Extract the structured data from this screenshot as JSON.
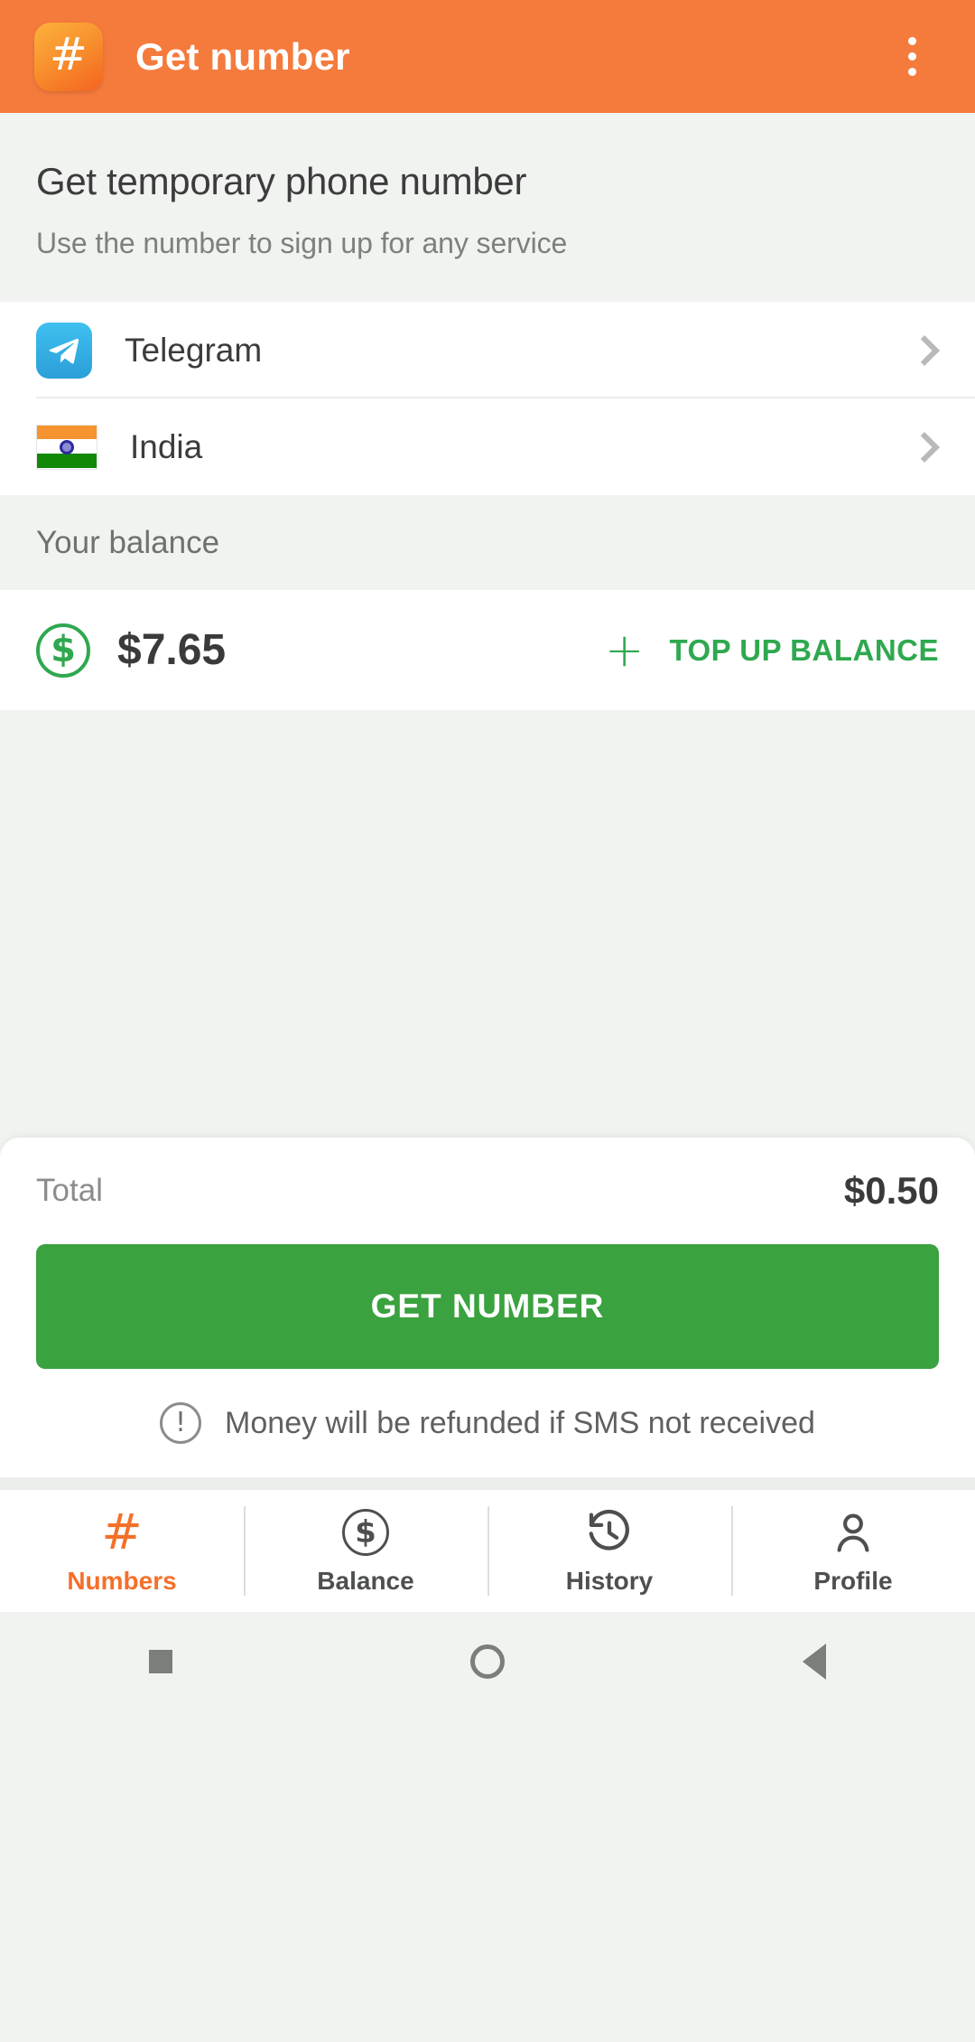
{
  "appbar": {
    "icon_name": "hash-app-icon",
    "icon_glyph": "#",
    "title": "Get number",
    "overflow_name": "more-options-icon"
  },
  "header": {
    "title": "Get temporary phone number",
    "subtitle": "Use the number to sign up for any service"
  },
  "selectors": {
    "service": {
      "label": "Telegram",
      "icon": "telegram-icon"
    },
    "country": {
      "label": "India",
      "icon": "india-flag-icon"
    }
  },
  "balance": {
    "section_label": "Your balance",
    "amount": "$7.65",
    "coin_icon": "dollar-circle-icon",
    "topup_plus": "+",
    "topup_label": "TOP UP BALANCE",
    "accent_color": "#2fa84f"
  },
  "sheet": {
    "total_label": "Total",
    "total_value": "$0.50",
    "cta_label": "GET NUMBER",
    "cta_color": "#3aa23f",
    "note_icon": "exclamation-circle-icon",
    "note_glyph": "!",
    "note_text": "Money will be refunded if SMS not received"
  },
  "tabbar": {
    "items": [
      {
        "label": "Numbers",
        "icon": "hash-icon",
        "active": true
      },
      {
        "label": "Balance",
        "icon": "dollar-circle-icon",
        "active": false
      },
      {
        "label": "History",
        "icon": "history-clock-icon",
        "active": false
      },
      {
        "label": "Profile",
        "icon": "person-icon",
        "active": false
      }
    ]
  },
  "sysnav": {
    "recents": "recents-square-icon",
    "home": "home-circle-icon",
    "back": "back-triangle-icon"
  },
  "colors": {
    "brand_orange": "#f57b3d",
    "green": "#2fa84f",
    "page_bg": "#f1f3f1"
  }
}
